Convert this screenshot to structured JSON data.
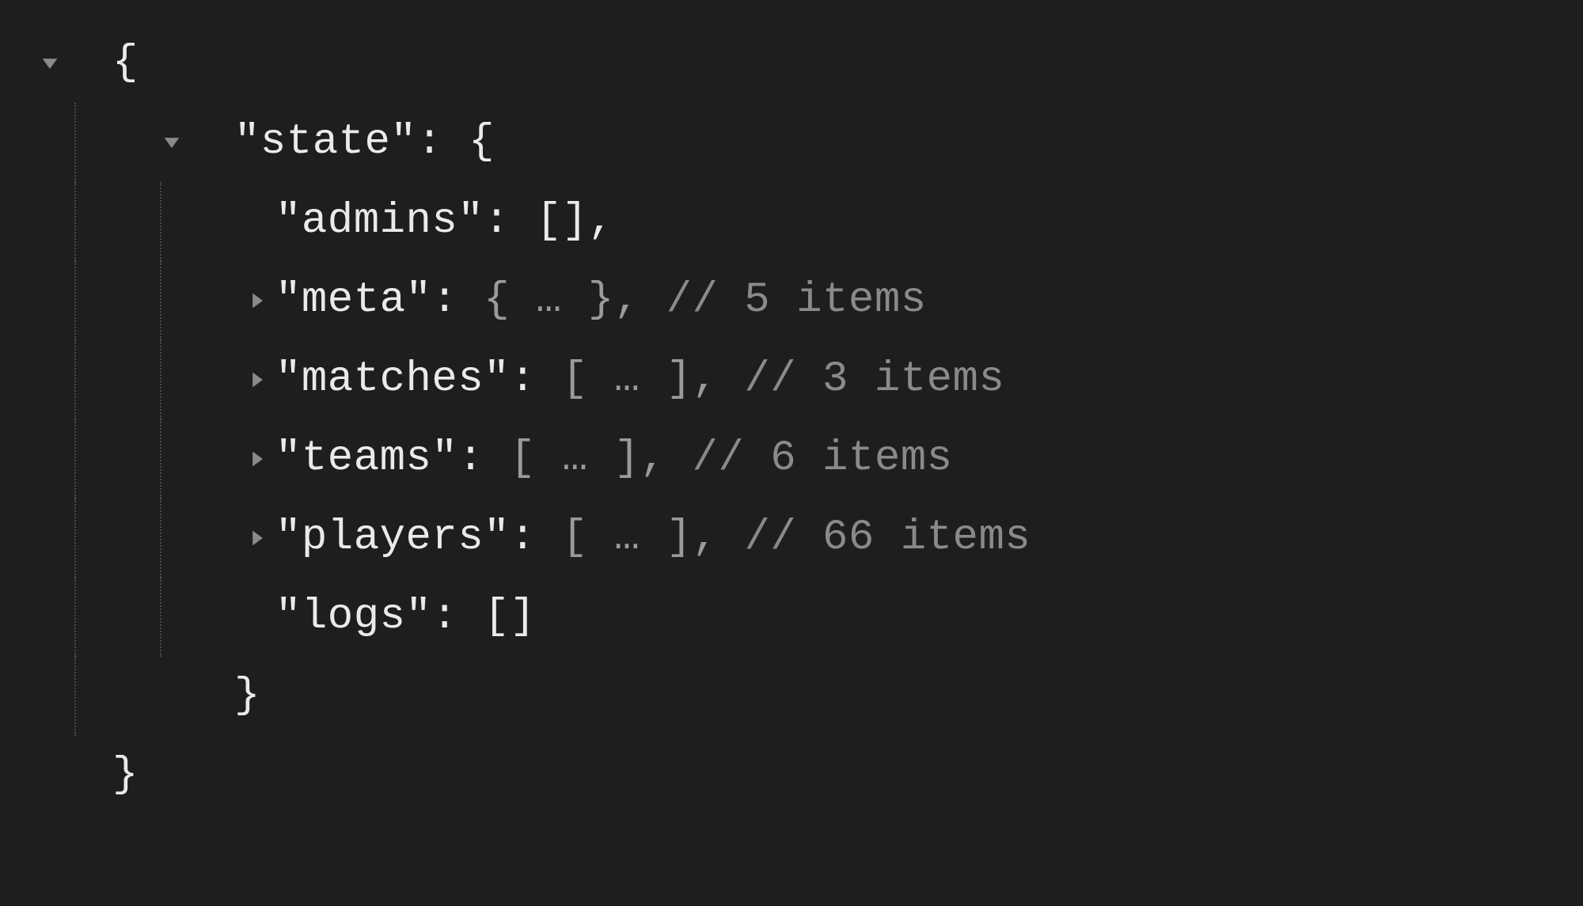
{
  "glyphs": {
    "open_brace": "{",
    "close_brace": "}",
    "colon_open_brace": ": {",
    "ellipsis_obj": "{ … },",
    "ellipsis_arr": "[ … ],",
    "empty_arr_comma": "[],",
    "empty_arr": "[]",
    "colon": ":",
    "quote": "\""
  },
  "root": {
    "key": "state",
    "children": {
      "admins": {
        "key": "admins",
        "value_display": "[],"
      },
      "meta": {
        "key": "meta",
        "value_display": "{ … },",
        "comment": "// 5 items"
      },
      "matches": {
        "key": "matches",
        "value_display": "[ … ],",
        "comment": "// 3 items"
      },
      "teams": {
        "key": "teams",
        "value_display": "[ … ],",
        "comment": "// 6 items"
      },
      "players": {
        "key": "players",
        "value_display": "[ … ],",
        "comment": "// 66 items"
      },
      "logs": {
        "key": "logs",
        "value_display": "[]"
      }
    }
  }
}
